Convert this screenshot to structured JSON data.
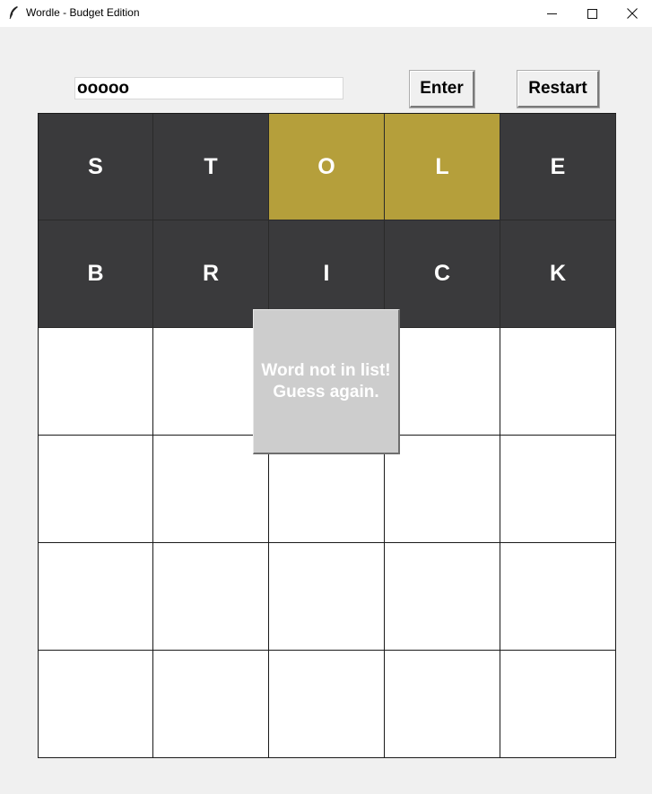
{
  "window": {
    "title": "Wordle - Budget Edition",
    "icon": "feather-icon",
    "controls": {
      "minimize": "minimize-icon",
      "maximize": "maximize-icon",
      "close": "close-icon"
    }
  },
  "input": {
    "value": "ooooo"
  },
  "buttons": {
    "enter_label": "Enter",
    "restart_label": "Restart"
  },
  "colors": {
    "absent": "#3a3a3c",
    "present": "#b59f3b",
    "empty": "#ffffff",
    "popup": "#cdcdcd"
  },
  "board": {
    "rows": [
      [
        {
          "letter": "S",
          "state": "absent"
        },
        {
          "letter": "T",
          "state": "absent"
        },
        {
          "letter": "O",
          "state": "present"
        },
        {
          "letter": "L",
          "state": "present"
        },
        {
          "letter": "E",
          "state": "absent"
        }
      ],
      [
        {
          "letter": "B",
          "state": "absent"
        },
        {
          "letter": "R",
          "state": "absent"
        },
        {
          "letter": "I",
          "state": "absent"
        },
        {
          "letter": "C",
          "state": "absent"
        },
        {
          "letter": "K",
          "state": "absent"
        }
      ],
      [
        {
          "letter": "",
          "state": "empty"
        },
        {
          "letter": "",
          "state": "empty"
        },
        {
          "letter": "",
          "state": "empty"
        },
        {
          "letter": "",
          "state": "empty"
        },
        {
          "letter": "",
          "state": "empty"
        }
      ],
      [
        {
          "letter": "",
          "state": "empty"
        },
        {
          "letter": "",
          "state": "empty"
        },
        {
          "letter": "",
          "state": "empty"
        },
        {
          "letter": "",
          "state": "empty"
        },
        {
          "letter": "",
          "state": "empty"
        }
      ],
      [
        {
          "letter": "",
          "state": "empty"
        },
        {
          "letter": "",
          "state": "empty"
        },
        {
          "letter": "",
          "state": "empty"
        },
        {
          "letter": "",
          "state": "empty"
        },
        {
          "letter": "",
          "state": "empty"
        }
      ],
      [
        {
          "letter": "",
          "state": "empty"
        },
        {
          "letter": "",
          "state": "empty"
        },
        {
          "letter": "",
          "state": "empty"
        },
        {
          "letter": "",
          "state": "empty"
        },
        {
          "letter": "",
          "state": "empty"
        }
      ]
    ]
  },
  "popup": {
    "line1": "Word not in list!",
    "line2": "Guess again."
  }
}
